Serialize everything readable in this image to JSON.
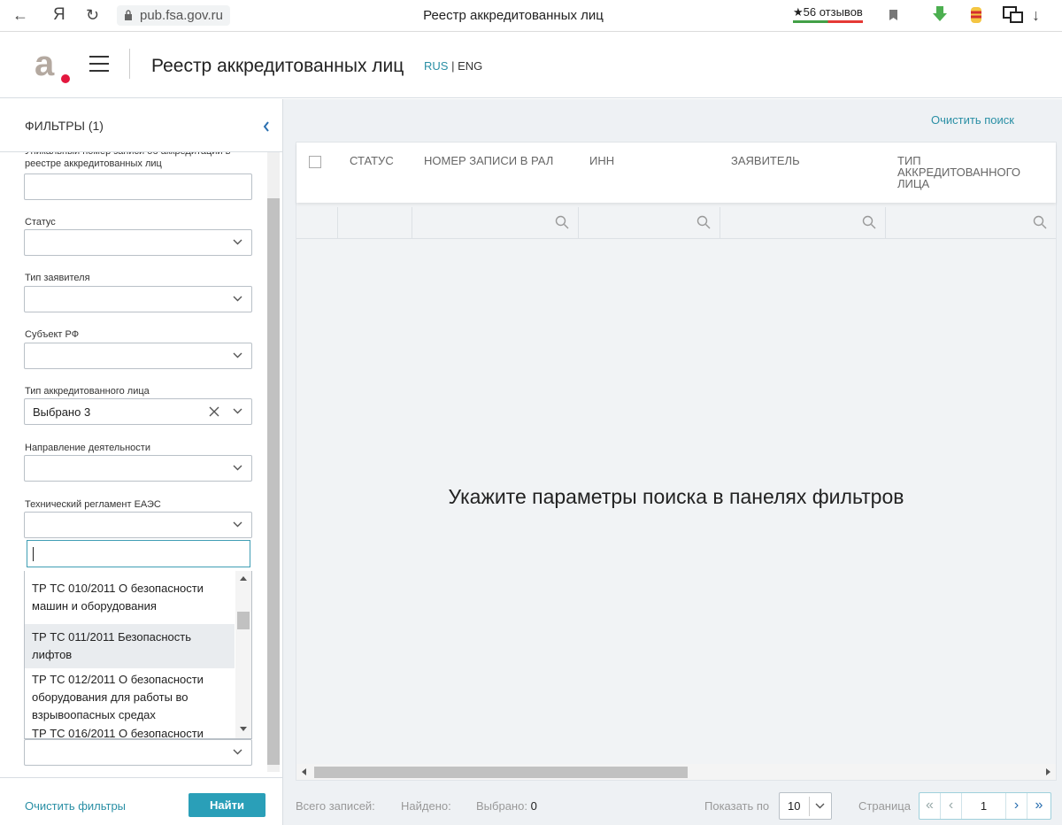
{
  "browser": {
    "url": "pub.fsa.gov.ru",
    "tab_title": "Реестр аккредитованных лиц",
    "reviews": "★56 отзывов",
    "back_icon": "←",
    "yandex_icon": "Я",
    "reload_icon": "↻",
    "download_icon": "↓"
  },
  "header": {
    "title": "Реестр аккредитованных лиц",
    "lang_rus": "RUS",
    "lang_sep": " | ",
    "lang_eng": "ENG"
  },
  "sidebar": {
    "title": "ФИЛЬТРЫ (1)",
    "filters": {
      "unique_label": "Уникальный номер записи об аккредитации в реестре аккредитованных лиц",
      "status_label": "Статус",
      "applicant_type_label": "Тип заявителя",
      "region_label": "Субъект РФ",
      "accredited_type_label": "Тип аккредитованного лица",
      "accredited_type_value": "Выбрано 3",
      "activity_label": "Направление деятельности",
      "regulation_label": "Технический регламент ЕАЭС"
    },
    "dropdown_items": [
      "ТР ТС 010/2011 О безопасности машин и оборудования",
      "ТР ТС 011/2011 Безопасность лифтов",
      "ТР ТС 012/2011 О безопасности оборудования для работы во взрывоопасных средах",
      "ТР ТС 016/2011 О безопасности"
    ],
    "clear_filters": "Очистить фильтры",
    "find_button": "Найти"
  },
  "main": {
    "clear_search": "Очистить поиск",
    "columns": [
      "СТАТУС",
      "НОМЕР ЗАПИСИ В РАЛ",
      "ИНН",
      "ЗАЯВИТЕЛЬ",
      "ТИП АККРЕДИТОВАННОГО ЛИЦА"
    ],
    "empty_message": "Укажите параметры поиска в панелях фильтров"
  },
  "footer": {
    "total_label": "Всего записей:",
    "found_label": "Найдено:",
    "selected_label": "Выбрано:",
    "selected_value": "0",
    "per_page_label": "Показать по",
    "per_page_value": "10",
    "page_label": "Страница",
    "page_value": "1"
  },
  "colors": {
    "accent": "#2a9fb8",
    "logo_red": "#e3173e",
    "logo_gray": "#b4a9a0"
  }
}
